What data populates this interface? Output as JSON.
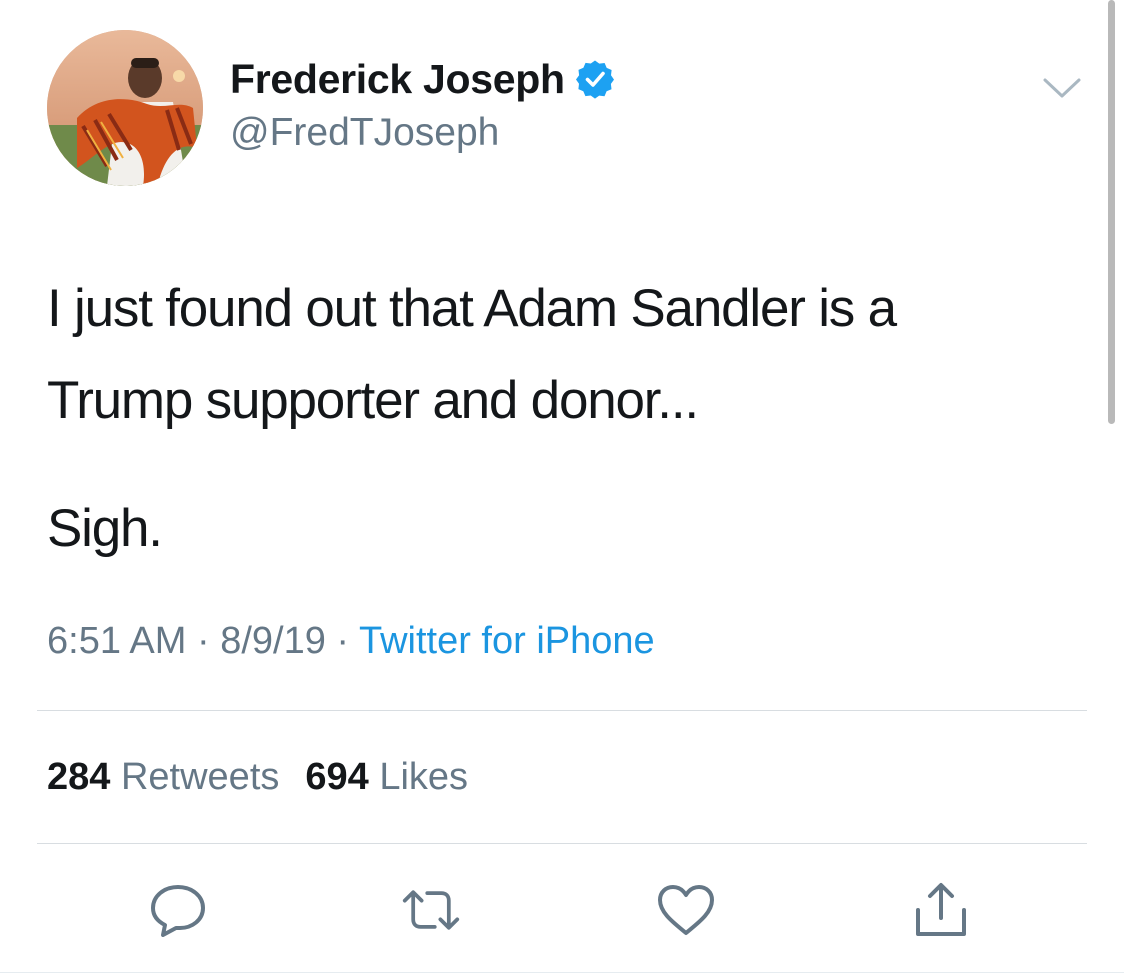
{
  "user": {
    "display_name": "Frederick Joseph",
    "handle": "@FredTJoseph",
    "verified": true,
    "avatar_icon": "profile-photo"
  },
  "tweet": {
    "lines": [
      "I just found out that Adam Sandler is a",
      "Trump supporter and donor...",
      "Sigh."
    ]
  },
  "meta": {
    "time": "6:51 AM",
    "sep1": " · ",
    "date": "8/9/19",
    "sep2": " · ",
    "source": "Twitter for iPhone"
  },
  "stats": {
    "retweets_count": "284",
    "retweets_label": "Retweets",
    "likes_count": "694",
    "likes_label": "Likes"
  },
  "actions": {
    "reply_icon": "reply-icon",
    "retweet_icon": "retweet-icon",
    "like_icon": "heart-icon",
    "share_icon": "share-icon"
  },
  "colors": {
    "text": "#14171a",
    "secondary": "#657786",
    "link": "#1b95e0",
    "verified": "#1da1f2",
    "divider": "#d8dde1"
  }
}
